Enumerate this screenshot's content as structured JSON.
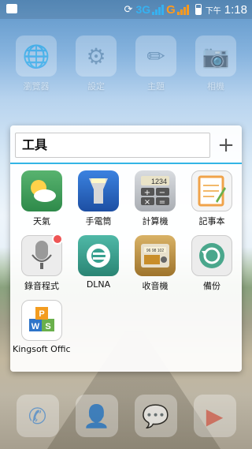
{
  "status_bar": {
    "network": "3G",
    "carrier_g": "G",
    "ampm": "下午",
    "time": "1:18"
  },
  "home": {
    "apps": [
      {
        "label": "瀏覽器",
        "icon": "browser-globe-icon"
      },
      {
        "label": "設定",
        "icon": "settings-gear-icon"
      },
      {
        "label": "主題",
        "icon": "theme-pencils-icon"
      },
      {
        "label": "相機",
        "icon": "camera-icon"
      }
    ]
  },
  "folder": {
    "name": "工具",
    "add_button": "+",
    "apps": [
      {
        "label": "天氣",
        "icon": "weather-icon",
        "bg": "#3f9c5b"
      },
      {
        "label": "手電筒",
        "icon": "flashlight-icon",
        "bg": "#2b68c6"
      },
      {
        "label": "計算機",
        "icon": "calculator-icon",
        "bg": "#c9cdd2"
      },
      {
        "label": "記事本",
        "icon": "notepad-icon",
        "bg": "#f1f1f1"
      },
      {
        "label": "錄音程式",
        "icon": "microphone-icon",
        "bg": "#eaeaea"
      },
      {
        "label": "DLNA",
        "icon": "dlna-icon",
        "bg": "#37a08f"
      },
      {
        "label": "收音機",
        "icon": "radio-icon",
        "bg": "#c99a46"
      },
      {
        "label": "備份",
        "icon": "backup-icon",
        "bg": "#49a489"
      },
      {
        "label": "Kingsoft Office",
        "icon": "kingsoft-office-icon",
        "bg": "#ffffff"
      }
    ]
  },
  "dock": [
    {
      "icon": "phone-icon"
    },
    {
      "icon": "contacts-icon"
    },
    {
      "icon": "messaging-icon"
    },
    {
      "icon": "play-store-icon"
    }
  ]
}
